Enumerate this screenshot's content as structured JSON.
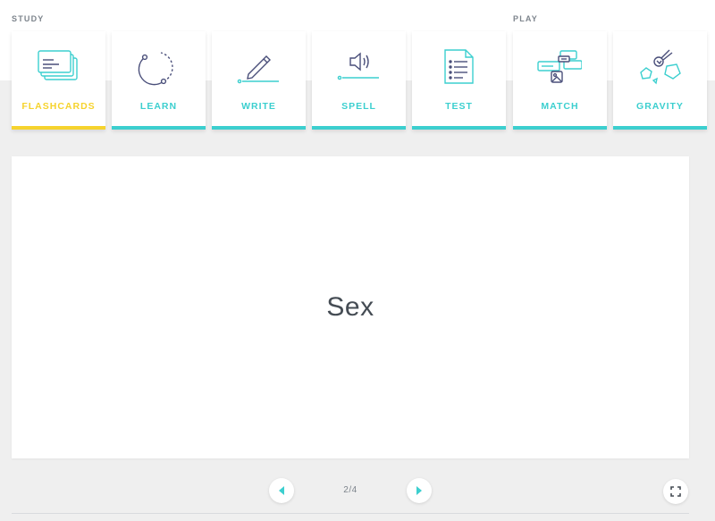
{
  "sections": {
    "study_label": "STUDY",
    "play_label": "PLAY"
  },
  "modes": [
    {
      "label": "FLASHCARDS",
      "icon": "flashcards-icon",
      "active": true
    },
    {
      "label": "LEARN",
      "icon": "learn-icon",
      "active": false
    },
    {
      "label": "WRITE",
      "icon": "write-icon",
      "active": false
    },
    {
      "label": "SPELL",
      "icon": "spell-icon",
      "active": false
    },
    {
      "label": "TEST",
      "icon": "test-icon",
      "active": false
    },
    {
      "label": "MATCH",
      "icon": "match-icon",
      "active": false
    },
    {
      "label": "GRAVITY",
      "icon": "gravity-icon",
      "active": false
    }
  ],
  "card": {
    "term": "Sex"
  },
  "navigation": {
    "counter": "2/4",
    "prev_icon": "arrow-left-icon",
    "next_icon": "arrow-right-icon",
    "fullscreen_icon": "fullscreen-icon"
  },
  "colors": {
    "accent": "#3ccfcf",
    "active": "#f6d32d",
    "icon_dark": "#4a4f7a",
    "text": "#454c54",
    "muted": "#7d848c",
    "background": "#efefef"
  }
}
